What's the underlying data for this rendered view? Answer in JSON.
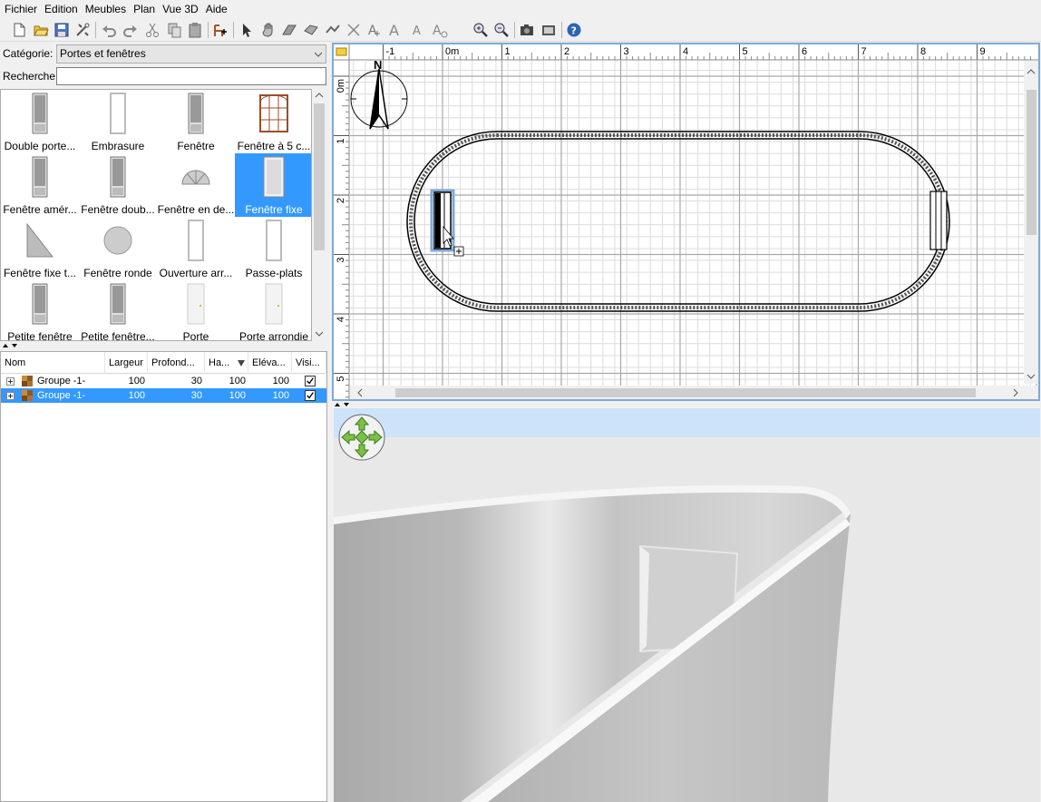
{
  "menu": [
    "Fichier",
    "Edition",
    "Meubles",
    "Plan",
    "Vue 3D",
    "Aide"
  ],
  "toolbar_icons": [
    "new-home-icon",
    "open-icon",
    "save-icon",
    "preferences-icon",
    "undo-icon",
    "redo-icon",
    "cut-icon",
    "copy-icon",
    "paste-icon",
    "add-furniture-icon",
    "select-mode-icon",
    "pan-mode-icon",
    "create-walls-icon",
    "create-rooms-icon",
    "create-polylines-icon",
    "create-dimensions-icon",
    "add-text-icon",
    "increase-text-icon",
    "decrease-text-icon",
    "modify-text-icon",
    "zoom-in-icon",
    "zoom-out-icon",
    "create-photo-icon",
    "create-video-icon",
    "help-icon"
  ],
  "catalog": {
    "category_label": "Catégorie:",
    "category_value": "Portes et fenêtres",
    "search_label": "Recherche:",
    "search_value": "",
    "items": [
      {
        "name": "Double porte...",
        "icon": "double-door-icon"
      },
      {
        "name": "Embrasure",
        "icon": "doorframe-icon"
      },
      {
        "name": "Fenêtre",
        "icon": "window-icon"
      },
      {
        "name": "Fenêtre à 5 c...",
        "icon": "window-5-panes-icon"
      },
      {
        "name": "Fenêtre amér...",
        "icon": "american-window-icon"
      },
      {
        "name": "Fenêtre doub...",
        "icon": "double-window-icon"
      },
      {
        "name": "Fenêtre en de...",
        "icon": "half-round-window-icon"
      },
      {
        "name": "Fenêtre fixe",
        "icon": "fixed-window-icon",
        "selected": true
      },
      {
        "name": "Fenêtre fixe t...",
        "icon": "triangular-window-icon"
      },
      {
        "name": "Fenêtre ronde",
        "icon": "round-window-icon"
      },
      {
        "name": "Ouverture arr...",
        "icon": "arched-opening-icon"
      },
      {
        "name": "Passe-plats",
        "icon": "service-hatch-icon"
      },
      {
        "name": "Petite fenêtre",
        "icon": "small-window-icon"
      },
      {
        "name": "Petite fenêtre...",
        "icon": "small-double-window-icon"
      },
      {
        "name": "Porte",
        "icon": "door-icon"
      },
      {
        "name": "Porte arrondie",
        "icon": "round-door-icon"
      }
    ]
  },
  "furniture_table": {
    "columns": [
      "Nom",
      "Largeur",
      "Profond...",
      "Ha...",
      "Eléva...",
      "Visi..."
    ],
    "rows": [
      {
        "name": "Groupe -1-",
        "width": "100",
        "depth": "30",
        "height": "100",
        "elevation": "100",
        "visible": true,
        "selected": false
      },
      {
        "name": "Groupe -1-",
        "width": "100",
        "depth": "30",
        "height": "100",
        "elevation": "100",
        "visible": true,
        "selected": true
      }
    ]
  },
  "plan": {
    "ruler_x": [
      "-1",
      "0m",
      "1",
      "2",
      "3",
      "4",
      "5",
      "6",
      "7",
      "8",
      "9"
    ],
    "ruler_y": [
      "0m",
      "1",
      "2",
      "3",
      "4",
      "5"
    ],
    "compass_label": "N"
  },
  "colors": {
    "selection": "#3399ff",
    "plan_border": "#7eaad6",
    "view3d_sky": "#cde3f9",
    "view3d_ground": "#e8e8e8"
  }
}
